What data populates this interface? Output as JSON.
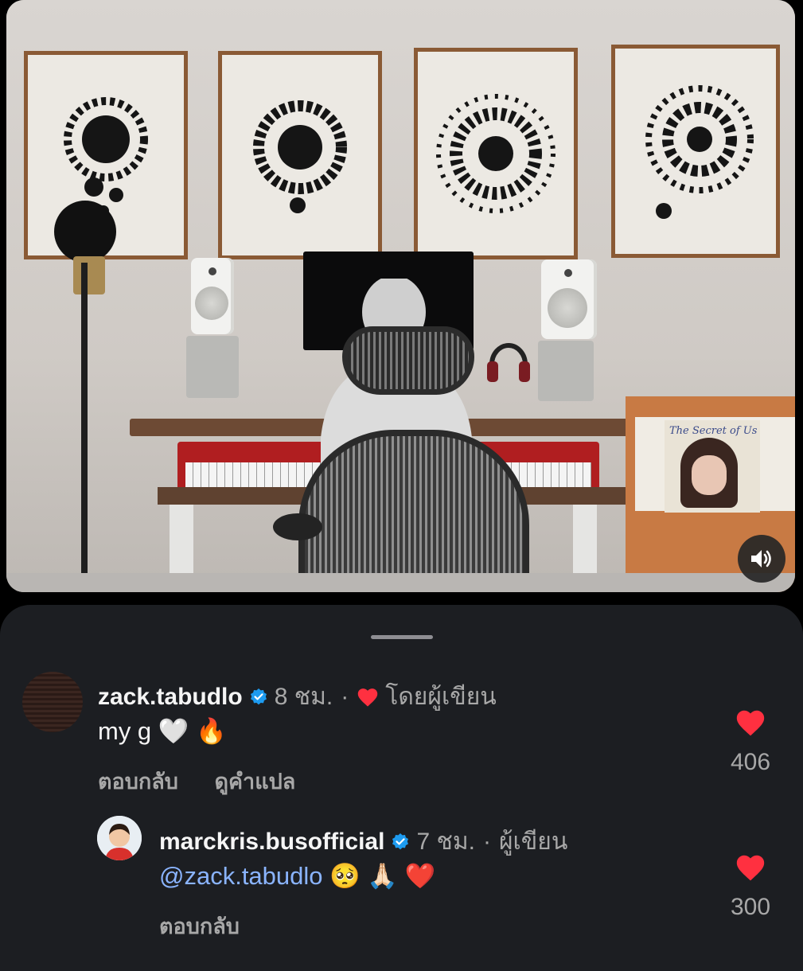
{
  "media": {
    "album_title": "The Secret of Us"
  },
  "comments": [
    {
      "username": "zack.tabudlo",
      "time": "8 ชม.",
      "liked_by_author_label": "โดยผู้เขียน",
      "text": "my g",
      "emoji": "🤍 🔥",
      "reply_label": "ตอบกลับ",
      "translate_label": "ดูคำแปล",
      "likes": "406"
    },
    {
      "username": "marckris.busofficial",
      "time": "7 ชม.",
      "author_label": "ผู้เขียน",
      "mention": "@zack.tabudlo",
      "emoji": "🥺 🙏🏻 ❤️",
      "reply_label": "ตอบกลับ",
      "likes": "300"
    }
  ],
  "colors": {
    "sheet_bg": "#1c1e22",
    "verified_blue": "#1d9bf0",
    "like_red": "#ff3040",
    "mention_blue": "#8ab4ff"
  },
  "icons": {
    "sound": "speaker-on-icon",
    "verified": "verified-badge-icon",
    "heart": "heart-icon"
  }
}
